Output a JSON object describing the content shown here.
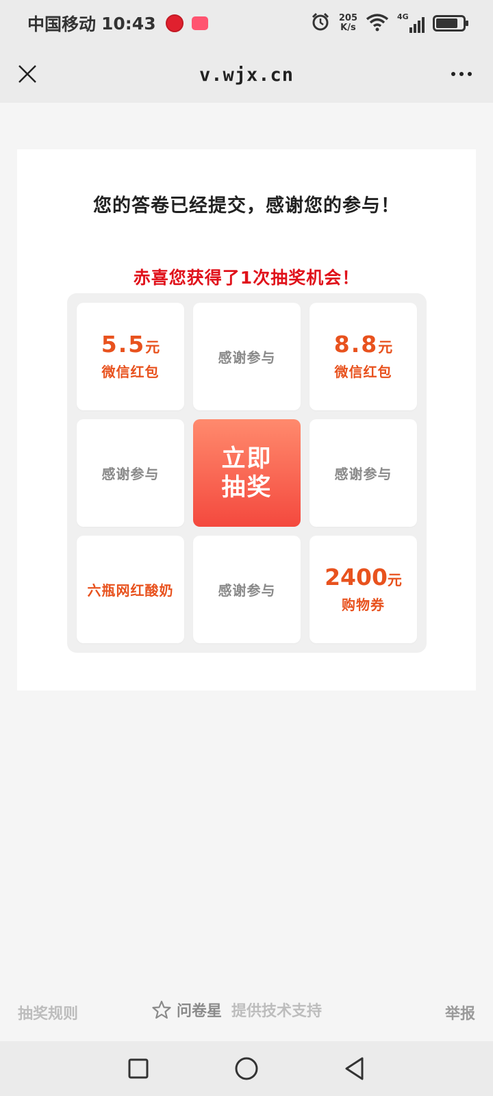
{
  "status_bar": {
    "carrier": "中国移动",
    "time": "10:43",
    "speed_value": "205",
    "speed_unit": "K/s",
    "network": "4G"
  },
  "nav": {
    "title": "v.wjx.cn"
  },
  "card": {
    "thanks_text": "您的答卷已经提交，感谢您的参与！",
    "congrats_text": "赤喜您获得了1次抽奖机会！"
  },
  "prizes": {
    "p1_amount": "5.5",
    "p1_unit": "元",
    "p1_name": "微信红包",
    "p2_text": "感谢参与",
    "p3_amount": "8.8",
    "p3_unit": "元",
    "p3_name": "微信红包",
    "p4_text": "感谢参与",
    "draw_line1": "立即",
    "draw_line2": "抽奖",
    "p6_text": "感谢参与",
    "p7_text": "六瓶网红酸奶",
    "p8_text": "感谢参与",
    "p9_amount": "2400",
    "p9_unit": "元",
    "p9_name": "购物券"
  },
  "footer": {
    "rules": "抽奖规则",
    "brand": "问卷星",
    "support": "提供技术支持",
    "report": "举报"
  },
  "colors": {
    "prize": "#e8521e",
    "congrats": "#e0121b",
    "draw_top": "#ff8a6d",
    "draw_bottom": "#f4493e"
  }
}
